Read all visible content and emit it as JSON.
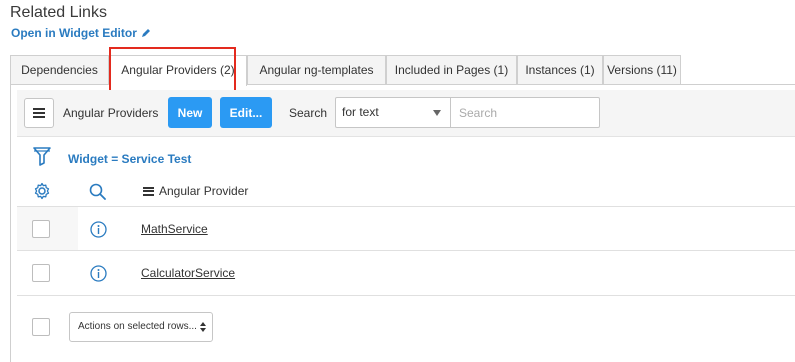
{
  "section": {
    "title": "Related Links",
    "widget_link": "Open in Widget Editor"
  },
  "tabs": [
    {
      "label": "Dependencies",
      "active": false
    },
    {
      "label": "Angular Providers (2)",
      "active": true
    },
    {
      "label": "Angular ng-templates",
      "active": false
    },
    {
      "label": "Included in Pages (1)",
      "active": false
    },
    {
      "label": "Instances (1)",
      "active": false
    },
    {
      "label": "Versions (11)",
      "active": false
    }
  ],
  "toolbar": {
    "list_title": "Angular Providers",
    "new_label": "New",
    "edit_label": "Edit...",
    "search_label": "Search",
    "search_field_selected": "for text",
    "search_placeholder": "Search"
  },
  "filter": {
    "text": "Widget = Service Test"
  },
  "table": {
    "column_header": "Angular Provider",
    "rows": [
      {
        "name": "MathService"
      },
      {
        "name": "CalculatorService"
      }
    ]
  },
  "footer": {
    "actions_label": "Actions on selected rows..."
  },
  "colors": {
    "accent": "#2b9af3",
    "link": "#2a7bc0",
    "highlight": "#e32a1e"
  },
  "icons": [
    "pencil-icon",
    "menu-icon",
    "caret-down-icon",
    "filter-icon",
    "gear-icon",
    "search-icon",
    "info-icon",
    "updown-icon"
  ]
}
